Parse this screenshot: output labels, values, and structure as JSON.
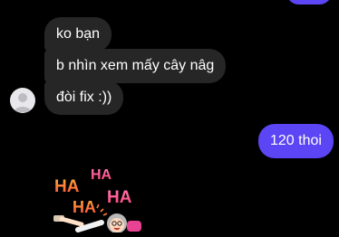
{
  "messages": [
    {
      "id": "m1",
      "direction": "incoming",
      "text": "ko bạn"
    },
    {
      "id": "m2",
      "direction": "incoming",
      "text": "b nhìn xem mấy cây nâg"
    },
    {
      "id": "m3",
      "direction": "incoming",
      "text": "đòi fix :))"
    },
    {
      "id": "m4",
      "direction": "outgoing",
      "text": "120 thoi"
    }
  ],
  "sticker": {
    "ha_text": "HA",
    "colors": [
      "#ff5a3c",
      "#ff7a3a",
      "#ff3f7f",
      "#ff9a3a"
    ]
  },
  "colors": {
    "background": "#000000",
    "incoming_bubble": "#262626",
    "outgoing_bubble": "#5b45f5"
  }
}
